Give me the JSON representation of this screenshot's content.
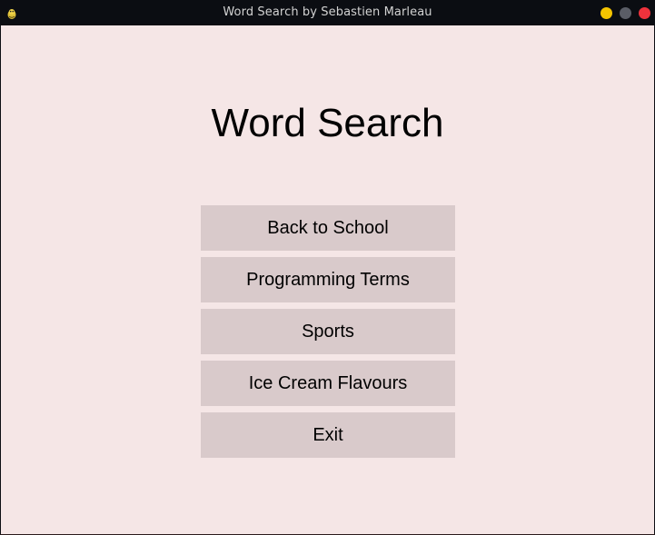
{
  "window": {
    "title": "Word Search by Sebastien Marleau",
    "app_icon": "pygame-snake-icon",
    "controls": {
      "minimize_color": "#f5c400",
      "maximize_color": "#5a5d66",
      "close_color": "#f0323c"
    }
  },
  "main": {
    "heading": "Word Search",
    "background_color": "#f5e6e6",
    "button_color": "#d9cacb",
    "menu": [
      {
        "label": "Back to School"
      },
      {
        "label": "Programming Terms"
      },
      {
        "label": "Sports"
      },
      {
        "label": "Ice Cream Flavours"
      },
      {
        "label": "Exit"
      }
    ]
  }
}
